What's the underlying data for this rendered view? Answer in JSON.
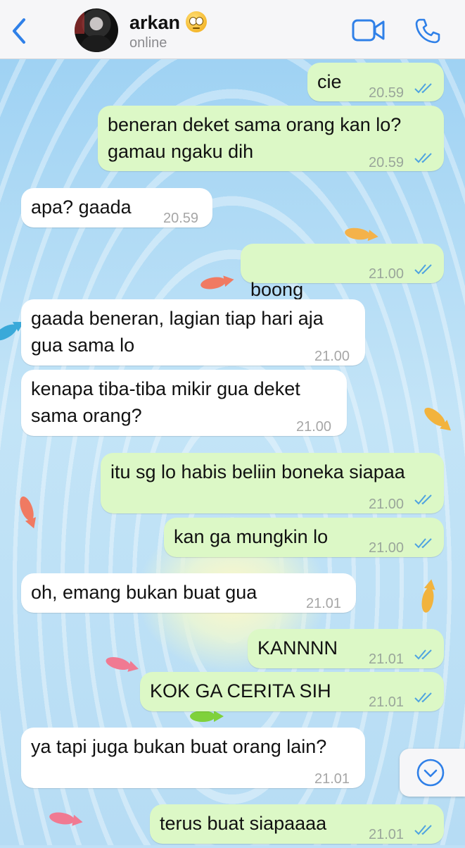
{
  "header": {
    "back_icon": "chevron-left-icon",
    "contact_name": "arkan",
    "status": "online",
    "video_icon": "video-camera-icon",
    "call_icon": "phone-icon",
    "accent_color": "#2f80e8"
  },
  "messages": [
    {
      "dir": "out",
      "text": "cie",
      "time": "20.59",
      "read": true
    },
    {
      "dir": "out",
      "text": "beneran deket sama orang kan lo?\ngamau ngaku dih",
      "time": "20.59",
      "read": true
    },
    {
      "dir": "in",
      "text": "apa? gaada",
      "time": "20.59"
    },
    {
      "dir": "out",
      "text": "boong",
      "emoji": "face-with-rolling-eyes",
      "time": "21.00",
      "read": true
    },
    {
      "dir": "in",
      "text": "gaada beneran, lagian tiap hari aja\ngua sama lo",
      "time": "21.00"
    },
    {
      "dir": "in",
      "text": "kenapa tiba-tiba mikir gua deket\nsama orang?",
      "time": "21.00"
    },
    {
      "dir": "out",
      "text": "itu sg lo habis beliin boneka siapaa",
      "time": "21.00",
      "read": true
    },
    {
      "dir": "out",
      "text": "kan ga mungkin lo",
      "time": "21.00",
      "read": true
    },
    {
      "dir": "in",
      "text": "oh, emang bukan buat gua",
      "time": "21.01"
    },
    {
      "dir": "out",
      "text": "KANNNN",
      "time": "21.01",
      "read": true
    },
    {
      "dir": "out",
      "text": "KOK GA CERITA SIH",
      "time": "21.01",
      "read": true
    },
    {
      "dir": "in",
      "text": "ya tapi juga bukan buat orang lain?",
      "time": "21.01"
    },
    {
      "dir": "out",
      "text": "terus buat siapaaaa",
      "time": "21.01",
      "read": true
    }
  ],
  "scroll_down_icon": "chevron-down-circle-icon",
  "colors": {
    "outgoing_bubble": "#dcf8c6",
    "incoming_bubble": "#ffffff",
    "read_check": "#4fa3e0"
  }
}
